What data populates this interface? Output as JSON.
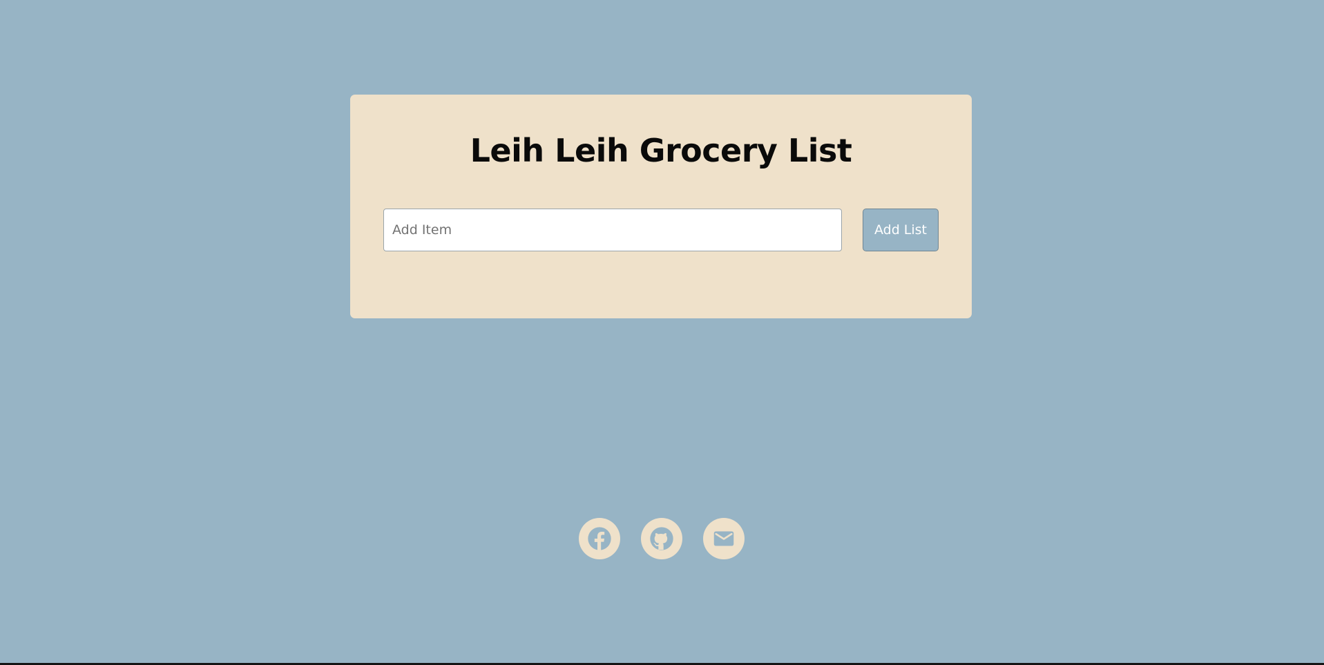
{
  "app": {
    "title": "Leih Leih Grocery List"
  },
  "form": {
    "input_placeholder": "Add Item",
    "input_value": "",
    "add_button_label": "Add List"
  },
  "footer": {
    "links": [
      {
        "name": "facebook",
        "icon": "facebook-icon"
      },
      {
        "name": "github",
        "icon": "github-icon"
      },
      {
        "name": "email",
        "icon": "mail-icon"
      }
    ]
  },
  "colors": {
    "background": "#97b4c5",
    "card": "#efe1ca",
    "button": "#97b4c5",
    "title_text": "#0a0a0a",
    "icon_fill": "#97b4c5"
  }
}
